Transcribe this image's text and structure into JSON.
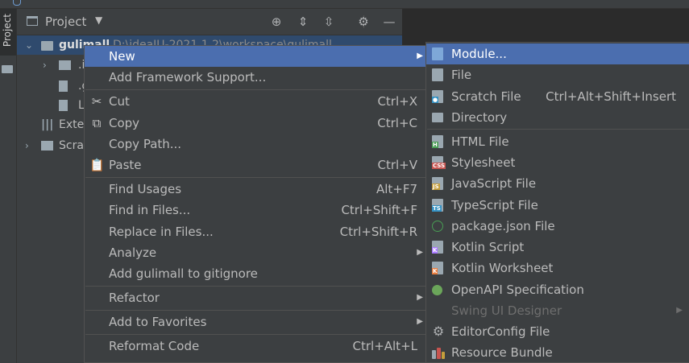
{
  "panel": {
    "title": "Project"
  },
  "tree": {
    "root_name": "gulimall",
    "root_path": "D:\\ideaIU-2021.1.2\\workspace\\gulimall",
    "child_1": ".i",
    "child_2": ".g",
    "child_3": "L",
    "external": "Exte",
    "scratches": "Scra"
  },
  "toolstrip": {
    "tab": "Project"
  },
  "context_menu": {
    "new": "New",
    "add_framework": "Add Framework Support...",
    "cut": "Cut",
    "cut_sc": "Ctrl+X",
    "copy": "Copy",
    "copy_sc": "Ctrl+C",
    "copy_path": "Copy Path...",
    "paste": "Paste",
    "paste_sc": "Ctrl+V",
    "find_usages": "Find Usages",
    "find_usages_sc": "Alt+F7",
    "find_in_files": "Find in Files...",
    "find_in_files_sc": "Ctrl+Shift+F",
    "replace_in_files": "Replace in Files...",
    "replace_in_files_sc": "Ctrl+Shift+R",
    "analyze": "Analyze",
    "add_gitignore": "Add gulimall to gitignore",
    "refactor": "Refactor",
    "add_favorites": "Add to Favorites",
    "reformat": "Reformat Code",
    "reformat_sc": "Ctrl+Alt+L"
  },
  "submenu": {
    "module": "Module...",
    "file": "File",
    "scratch": "Scratch File",
    "scratch_sc": "Ctrl+Alt+Shift+Insert",
    "directory": "Directory",
    "html": "HTML File",
    "stylesheet": "Stylesheet",
    "javascript": "JavaScript File",
    "typescript": "TypeScript File",
    "package_json": "package.json File",
    "kotlin_script": "Kotlin Script",
    "kotlin_worksheet": "Kotlin Worksheet",
    "openapi": "OpenAPI Specification",
    "swing": "Swing UI Designer",
    "editorconfig": "EditorConfig File",
    "resource_bundle": "Resource Bundle"
  }
}
